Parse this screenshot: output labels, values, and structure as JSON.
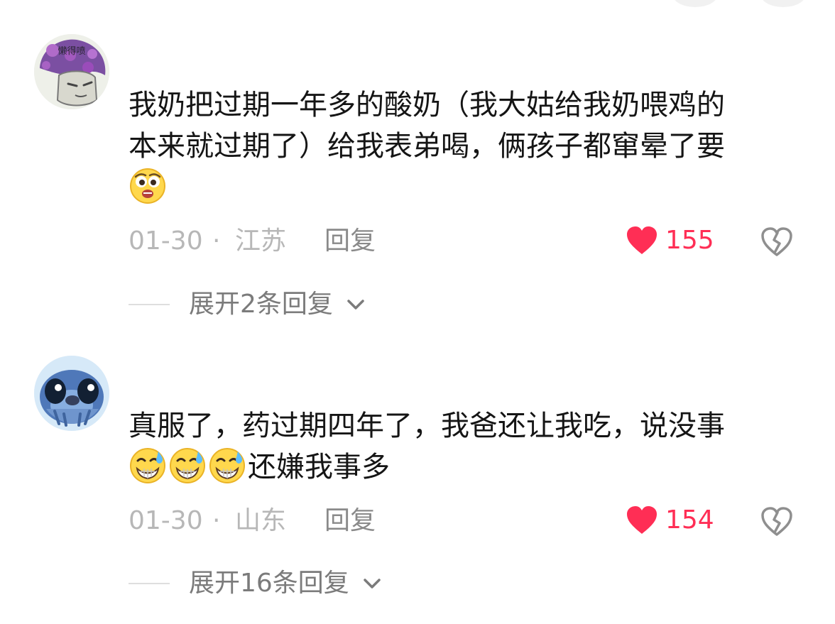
{
  "comments": [
    {
      "avatar": "purple-mushroom-avatar",
      "avatar_text": "懒得喷",
      "text_lines": [
        "我奶把过期一年多的酸奶（我大姑给我奶喂鸡的",
        "本来就过期了）给我表弟喝，俩孩子都窜晕了要"
      ],
      "emojis": [
        "worried-face-emoji"
      ],
      "trailing_text": "",
      "date": "01-30",
      "separator": "·",
      "location": "江苏",
      "reply_label": "回复",
      "like_count": "155",
      "expand_label": "展开2条回复"
    },
    {
      "avatar": "blue-stitch-avatar",
      "avatar_text": "",
      "text_lines": [
        "真服了，药过期四年了，我爸还让我吃，说没事"
      ],
      "emojis": [
        "grin-sweat-emoji",
        "grin-sweat-emoji",
        "grin-sweat-emoji"
      ],
      "trailing_text": "还嫌我事多",
      "date": "01-30",
      "separator": "·",
      "location": "山东",
      "reply_label": "回复",
      "like_count": "154",
      "expand_label": "展开16条回复"
    }
  ],
  "icons": {
    "heart": "heart-icon",
    "dislike": "broken-heart-icon",
    "expand": "chevron-down-icon"
  },
  "colors": {
    "like": "#ff2e55",
    "meta": "#b7b7b7",
    "reply": "#8a8a8a",
    "text": "#151515"
  }
}
